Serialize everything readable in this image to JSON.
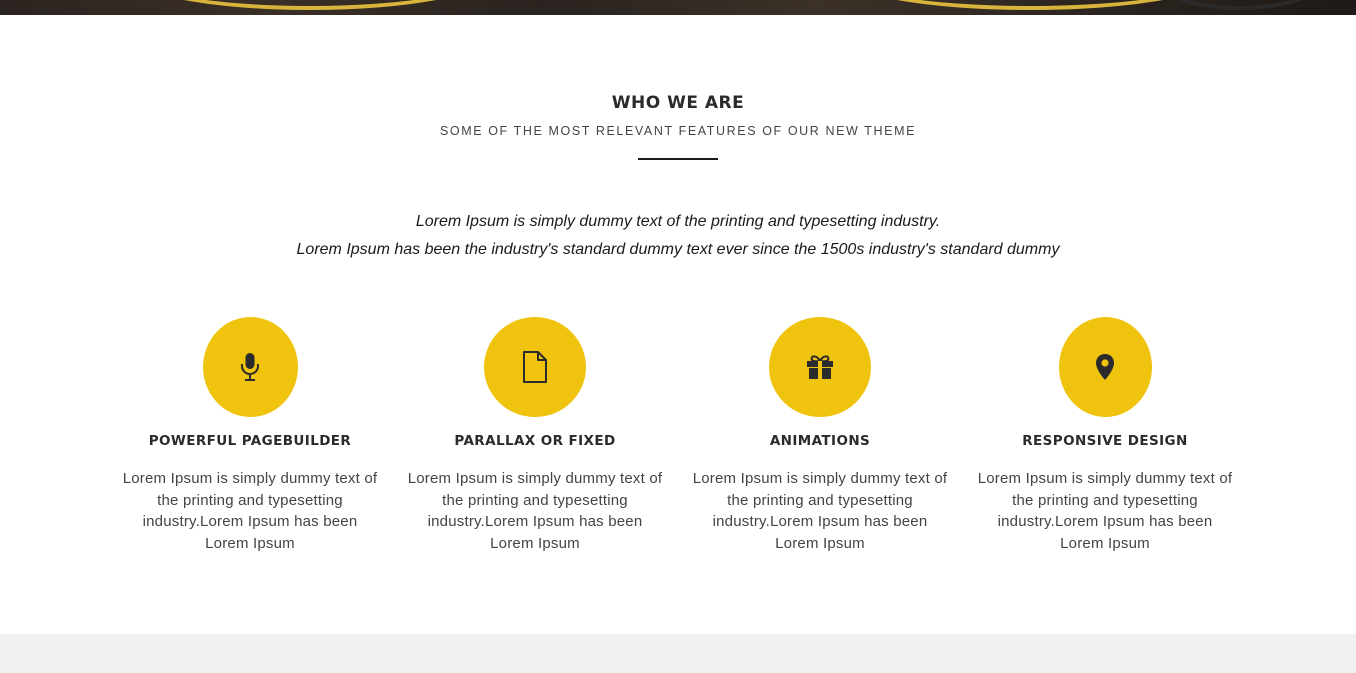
{
  "section": {
    "title": "WHO WE ARE",
    "subtitle": "SOME OF THE MOST RELEVANT FEATURES OF OUR NEW THEME",
    "intro_line1": "Lorem Ipsum is simply dummy text of the printing and typesetting industry.",
    "intro_line2": "Lorem Ipsum has been the industry's standard dummy text ever since the 1500s industry's standard dummy"
  },
  "features": [
    {
      "icon": "microphone-icon",
      "title": "POWERFUL PAGEBUILDER",
      "text": "Lorem Ipsum is simply dummy text of the printing and typesetting industry.Lorem Ipsum has been Lorem Ipsum"
    },
    {
      "icon": "document-icon",
      "title": "PARALLAX OR FIXED",
      "text": "Lorem Ipsum is simply dummy text of the printing and typesetting industry.Lorem Ipsum has been Lorem Ipsum"
    },
    {
      "icon": "gift-icon",
      "title": "ANIMATIONS",
      "text": "Lorem Ipsum is simply dummy text of the printing and typesetting industry.Lorem Ipsum has been Lorem Ipsum"
    },
    {
      "icon": "map-pin-icon",
      "title": "RESPONSIVE DESIGN",
      "text": "Lorem Ipsum is simply dummy text of the printing and typesetting industry.Lorem Ipsum has been Lorem Ipsum"
    }
  ],
  "colors": {
    "accent": "#f0c30f",
    "heading": "#2b2b2b",
    "body_text": "#444444",
    "footer_band": "#f0f0f0"
  }
}
